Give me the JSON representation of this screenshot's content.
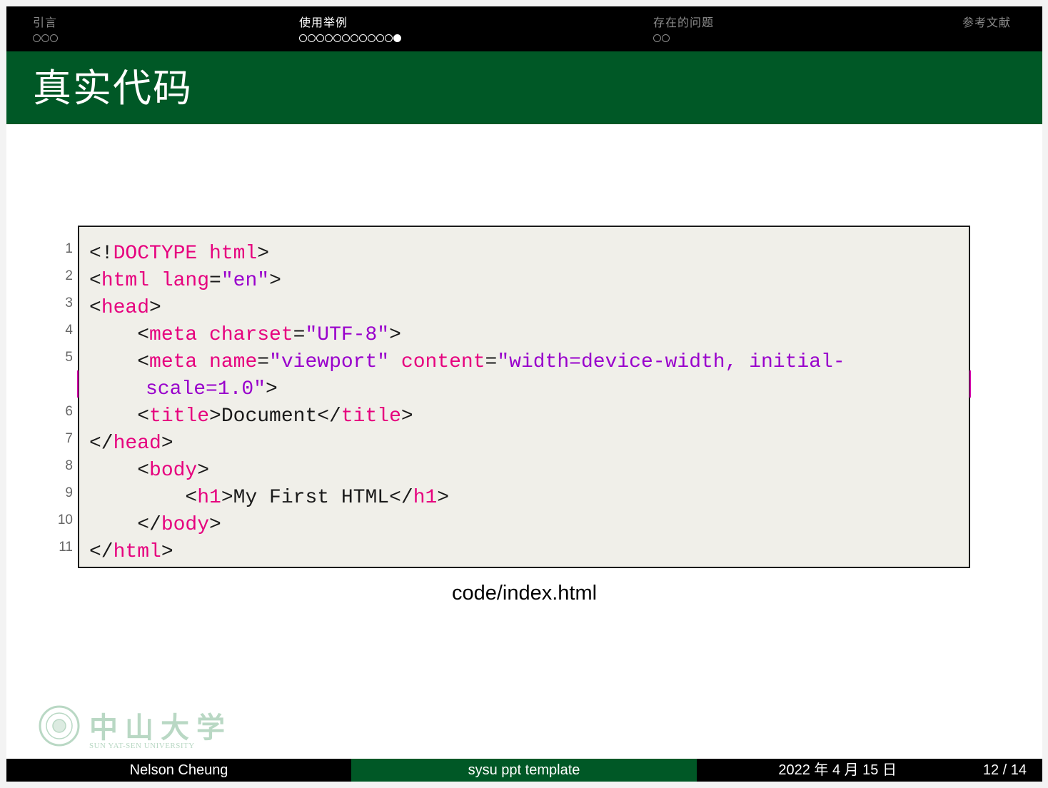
{
  "nav": {
    "sections": [
      {
        "title": "引言",
        "dots": 3,
        "current": -1
      },
      {
        "title": "使用举例",
        "dots": 12,
        "current": 11
      },
      {
        "title": "存在的问题",
        "dots": 2,
        "current": -1
      },
      {
        "title": "参考文献",
        "dots": 0,
        "current": -1
      }
    ],
    "active_section": 1
  },
  "frame": {
    "title": "真实代码"
  },
  "code": {
    "line_numbers": [
      "1",
      "2",
      "3",
      "4",
      "5",
      "6",
      "7",
      "8",
      "9",
      "10",
      "11"
    ],
    "caption": "code/index.html"
  },
  "logo": {
    "name": "中山大学",
    "english": "SUN YAT-SEN UNIVERSITY"
  },
  "footer": {
    "author": "Nelson Cheung",
    "title": "sysu ppt template",
    "date": "2022 年 4 月 15 日",
    "page": "12 / 14"
  },
  "colors": {
    "brand_green": "#005826",
    "keyword": "#e6007e",
    "string": "#9900cc",
    "code_bg": "#f0efe9"
  }
}
